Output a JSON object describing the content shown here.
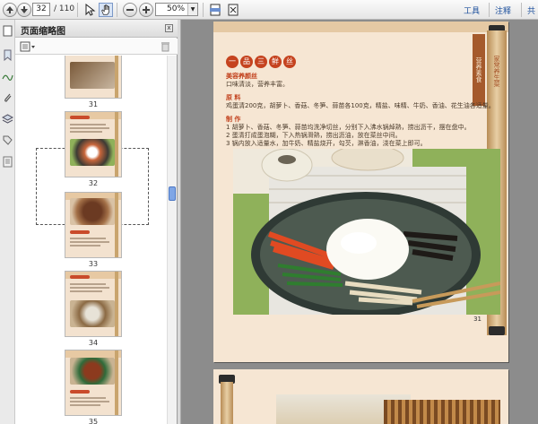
{
  "toolbar": {
    "current_page": "32",
    "page_total": "/ 110",
    "zoom": "50%",
    "tools_label": "工具",
    "comment_label": "注释",
    "share_label": "共"
  },
  "panel": {
    "title": "页面缩略图",
    "close_label": "x",
    "thumbnails": [
      {
        "label": "31"
      },
      {
        "label": "32"
      },
      {
        "label": "33"
      },
      {
        "label": "34"
      },
      {
        "label": "35"
      }
    ]
  },
  "page": {
    "dish_chars": [
      "一",
      "品",
      "三",
      "鲜",
      "丝"
    ],
    "subtitle": "美容养颜丝",
    "subtitle2": "口味清淡，营养丰富。",
    "ingredients_heading": "原 料",
    "ingredients_text": "鸡蛋清200克，胡萝卜、香菇、冬笋、蒜苗各100克，精盐、味精、牛奶、香油、花生油各适量。",
    "method_heading": "制 作",
    "steps": [
      "1  胡萝卜、香菇、冬笋、蒜苗均洗净切丝，分别下入沸水锅焯熟，捞出沥干，摆在盘中。",
      "2  蛋清打成蛋泡糊，下入热锅滑熟，捞出沥油，放在菜丝中间。",
      "3  锅内放入适量水，加牛奶、精盐烧开，勾芡，淋香油，浇在菜上即可。"
    ],
    "side_tab": "营养素食",
    "side_tab2": "家常养生菜",
    "page_number": "31"
  },
  "colors": {
    "accent_red": "#c5431f",
    "page_bg": "#f6e6d3",
    "link_blue": "#1c4f9c"
  }
}
